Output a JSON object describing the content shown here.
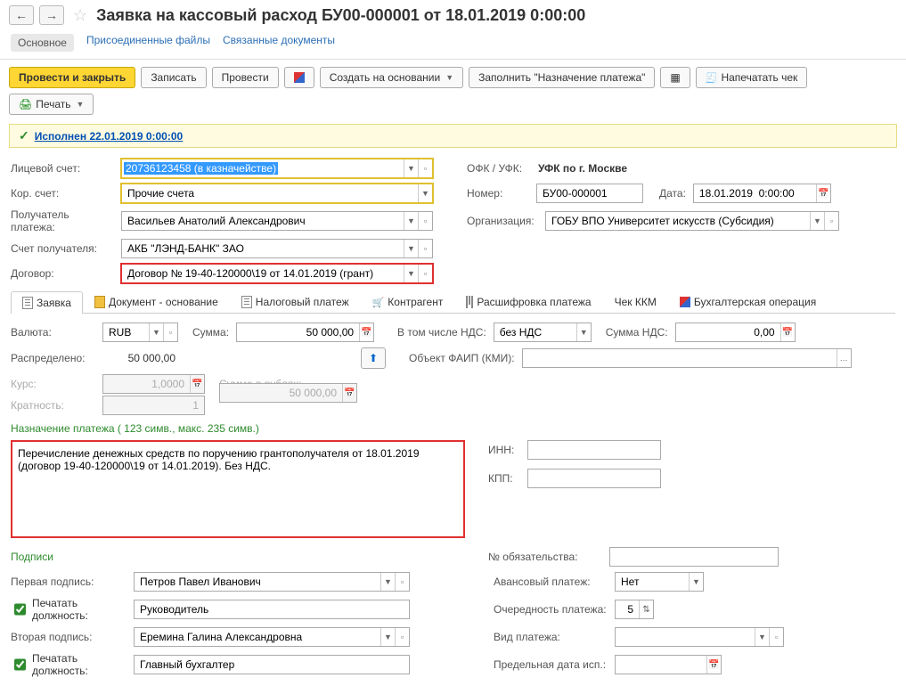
{
  "header": {
    "title": "Заявка на кассовый расход БУ00-000001 от 18.01.2019 0:00:00"
  },
  "topTabs": {
    "main": "Основное",
    "attached": "Присоединенные файлы",
    "related": "Связанные документы"
  },
  "toolbar": {
    "postClose": "Провести и закрыть",
    "save": "Записать",
    "post": "Провести",
    "createFrom": "Создать на основании",
    "fillPurpose": "Заполнить \"Назначение платежа\"",
    "printCheck": "Напечатать чек",
    "print": "Печать"
  },
  "status": {
    "text": "Исполнен 22.01.2019 0:00:00"
  },
  "fields": {
    "account_lbl": "Лицевой счет:",
    "account_val": "20736123458 (в казначействе)",
    "corr_lbl": "Кор. счет:",
    "corr_val": "Прочие счета",
    "ofk_lbl": "ОФК / УФК:",
    "ofk_val": "УФК по г. Москве",
    "number_lbl": "Номер:",
    "number_val": "БУ00-000001",
    "date_lbl": "Дата:",
    "date_val": "18.01.2019  0:00:00",
    "payee_lbl": "Получатель платежа:",
    "payee_val": "Васильев Анатолий Александрович",
    "org_lbl": "Организация:",
    "org_val": "ГОБУ ВПО Университет искусств (Субсидия)",
    "payacct_lbl": "Счет получателя:",
    "payacct_val": "АКБ \"ЛЭНД-БАНК\" ЗАО",
    "contract_lbl": "Договор:",
    "contract_val": "Договор № 19-40-120000\\19 от 14.01.2019 (грант)"
  },
  "subtabs": {
    "app": "Заявка",
    "basis": "Документ - основание",
    "tax": "Налоговый платеж",
    "counter": "Контрагент",
    "decode": "Расшифровка платежа",
    "kkm": "Чек ККМ",
    "acc": "Бухгалтерская операция"
  },
  "appTab": {
    "currency_lbl": "Валюта:",
    "currency_val": "RUB",
    "sum_lbl": "Сумма:",
    "sum_val": "50 000,00",
    "vat_lbl": "В том числе НДС:",
    "vat_val": "без НДС",
    "vatsum_lbl": "Сумма НДС:",
    "vatsum_val": "0,00",
    "distr_lbl": "Распределено:",
    "distr_val": "50 000,00",
    "faip_lbl": "Объект ФАИП (КМИ):",
    "faip_val": "",
    "rate_lbl": "Курс:",
    "rate_val": "1,0000",
    "sumrub_lbl": "Сумма в рублях:",
    "sumrub_val": "50 000,00",
    "mult_lbl": "Кратность:",
    "mult_val": "1",
    "purpose_heading": "Назначение платежа ( 123 симв., макс. 235 симв.)",
    "purpose_text": "Перечисление денежных средств по поручению грантополучателя от 18.01.2019 (договор 19-40-120000\\19 от 14.01.2019). Без НДС.",
    "inn_lbl": "ИНН:",
    "kpp_lbl": "КПП:",
    "sign_heading": "Подписи",
    "obligation_lbl": "№ обязательства:",
    "sign1_lbl": "Первая подпись:",
    "sign1_val": "Петров Павел Иванович",
    "advance_lbl": "Авансовый платеж:",
    "advance_val": "Нет",
    "printpos1_lbl": "Печатать должность:",
    "printpos1_val": "Руководитель",
    "priority_lbl": "Очередность платежа:",
    "priority_val": "5",
    "sign2_lbl": "Вторая подпись:",
    "sign2_val": "Еремина Галина Александровна",
    "paytype_lbl": "Вид платежа:",
    "printpos2_lbl": "Печатать должность:",
    "printpos2_val": "Главный бухгалтер",
    "deadline_lbl": "Предельная дата исп.:"
  }
}
